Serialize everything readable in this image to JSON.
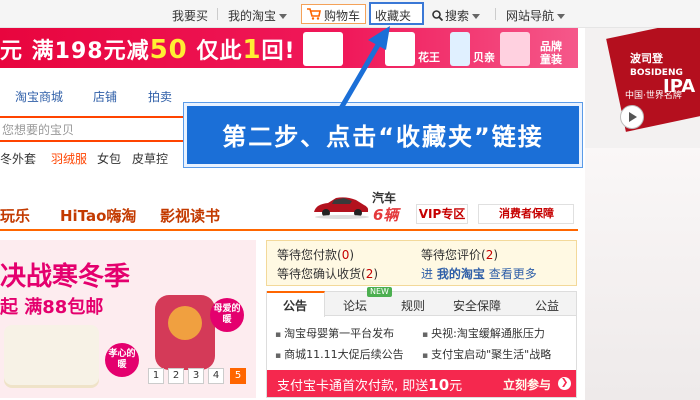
{
  "topnav": {
    "buy": "我要买",
    "my_taobao": "我的淘宝",
    "cart": "购物车",
    "favorites": "收藏夹",
    "search": "搜索",
    "site_nav": "网站导航"
  },
  "promo": {
    "text_prefix": "元 满198元减",
    "amount": "50",
    "text_mid": " 仅此",
    "one": "1",
    "text_end": "回!",
    "products": [
      "花王",
      "贝亲",
      "品牌童装"
    ]
  },
  "right_ad": {
    "brand": "波司登",
    "brand_en": "BOSIDENG",
    "sub": "中国·世界名牌",
    "ipa": "IPA"
  },
  "tabs": [
    "淘宝商城",
    "店铺",
    "拍卖"
  ],
  "search": {
    "placeholder": "您想要的宝贝"
  },
  "hot_words": [
    "冬外套",
    "羽绒服",
    "女包",
    "皮草控"
  ],
  "instruction": "第二步、点击“收藏夹”链接",
  "categories": [
    "玩乐",
    "HiTao嗨淘",
    "影视读书"
  ],
  "car": {
    "label": "汽车",
    "count": "6辆"
  },
  "vip": "VIP专区",
  "consumer": "消费者保障",
  "left_promo": {
    "title": "决战寒冬季",
    "sub": "起 满88包邮",
    "badge1": "母爱的暖",
    "badge2": "孝心的暖",
    "pages": [
      "1",
      "2",
      "3",
      "4",
      "5"
    ]
  },
  "summary": {
    "pending_pay": "等待您付款(",
    "pending_pay_n": "0",
    "pending_review": "等待您评价(",
    "pending_review_n": "2",
    "pending_confirm": "等待您确认收货(",
    "pending_confirm_n": "2",
    "enter": "进",
    "my_taobao": "我的淘宝",
    "see_more": "查看更多",
    "close": ")"
  },
  "notice_tabs": [
    "公告",
    "论坛",
    "规则",
    "安全保障",
    "公益"
  ],
  "new_badge": "NEW",
  "news": [
    "淘宝母婴第一平台发布",
    "央视:淘宝缓解通胀压力",
    "商城11.11大促后续公告",
    "支付宝启动\"聚生活\"战略"
  ],
  "alipay": {
    "text": "支付宝卡通首次付款, 即送",
    "amount": "10",
    "unit": "元",
    "cta": "立刻参与"
  }
}
